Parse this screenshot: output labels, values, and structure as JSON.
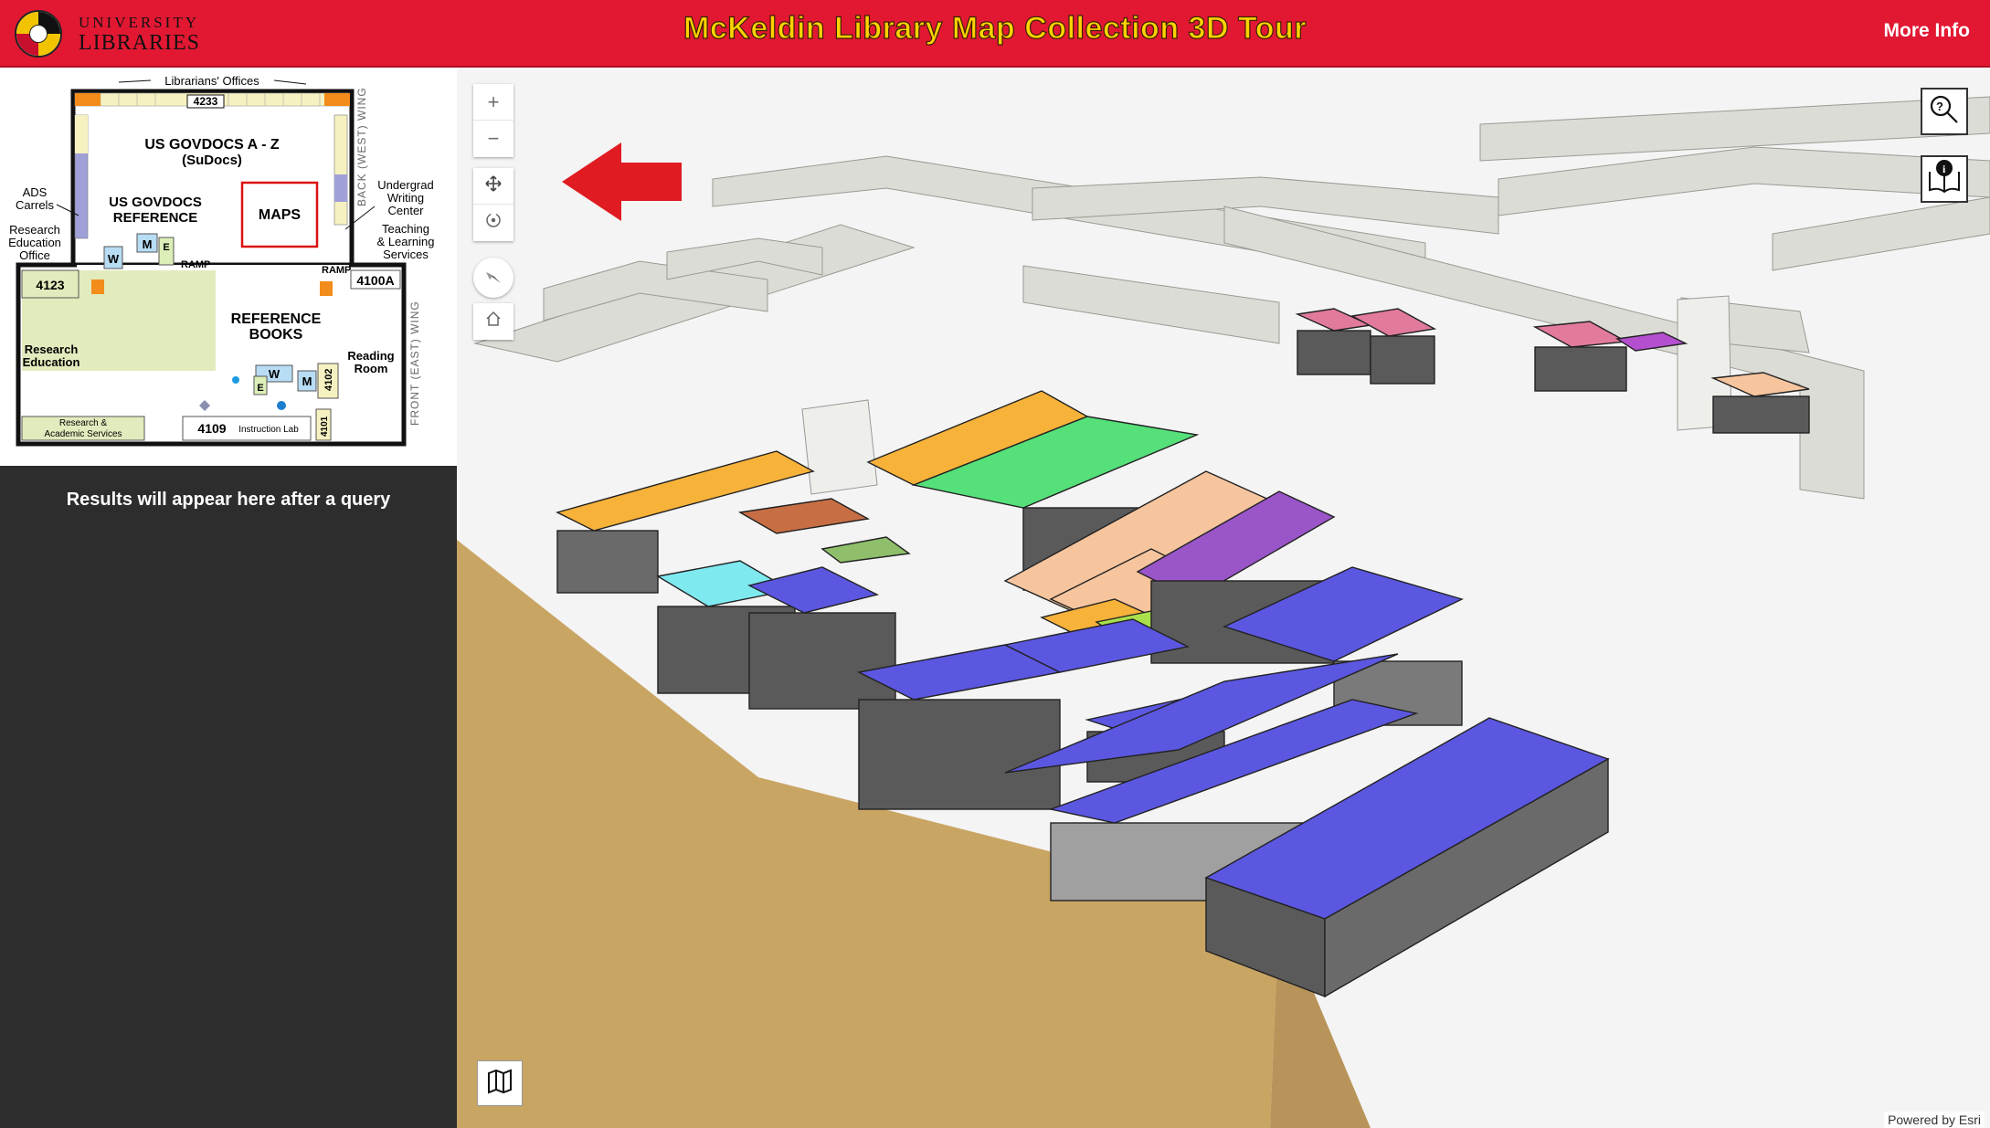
{
  "header": {
    "logo_line1": "UNIVERSITY",
    "logo_line2": "LIBRARIES",
    "title": "McKeldin Library Map Collection 3D Tour",
    "more_info": "More Info"
  },
  "floorplan": {
    "librarians_offices": "Librarians' Offices",
    "room_4233": "4233",
    "govdocs_az": "US GOVDOCS A - Z",
    "sudocs": "(SuDocs)",
    "govdocs_ref_1": "US GOVDOCS",
    "govdocs_ref_2": "REFERENCE",
    "maps": "MAPS",
    "back_wing": "BACK (WEST) WING",
    "front_wing": "FRONT (EAST) WING",
    "ads_1": "ADS",
    "ads_2": "Carrels",
    "research_ed_1": "Research",
    "research_ed_2": "Education",
    "research_ed_3": "Office",
    "writing_1": "Undergrad",
    "writing_2": "Writing",
    "writing_3": "Center",
    "teaching_1": "Teaching",
    "teaching_2": "& Learning",
    "teaching_3": "Services",
    "room_4123": "4123",
    "room_4100a": "4100A",
    "ramp": "RAMP",
    "ref_books_1": "REFERENCE",
    "ref_books_2": "BOOKS",
    "research_1": "Research",
    "research_2": "Education",
    "reading_1": "Reading",
    "reading_2": "Room",
    "ras_1": "Research &",
    "ras_2": "Academic Services",
    "room_4109": "4109",
    "instruction_lab": "Instruction Lab",
    "room_4102": "4102",
    "room_4101": "4101",
    "w": "W",
    "m": "M",
    "e": "E"
  },
  "results": {
    "message": "Results will appear here after a query"
  },
  "nav": {
    "zoom_in": "+",
    "zoom_out": "−"
  },
  "attribution": "Powered by Esri",
  "colors": {
    "header_red": "#e21833",
    "title_gold": "#ffd200",
    "arrow_red": "#e01b22",
    "sidebar_dark": "#2d2d2d",
    "floor_tan": "#c9a564",
    "shelf_blue": "#5b57e0",
    "shelf_green": "#55e07a",
    "shelf_peach": "#f6c59e",
    "shelf_orange": "#f7b23a",
    "shelf_pink": "#e27a9c",
    "shelf_cyan": "#7fe9f0",
    "shelf_lime": "#a9e04c"
  },
  "icons": {
    "pan": "pan-icon",
    "rotate": "rotate-icon",
    "compass": "compass-icon",
    "home": "home-icon",
    "search_help": "search-help-icon",
    "book_info": "book-info-icon",
    "basemap": "basemap-icon"
  }
}
